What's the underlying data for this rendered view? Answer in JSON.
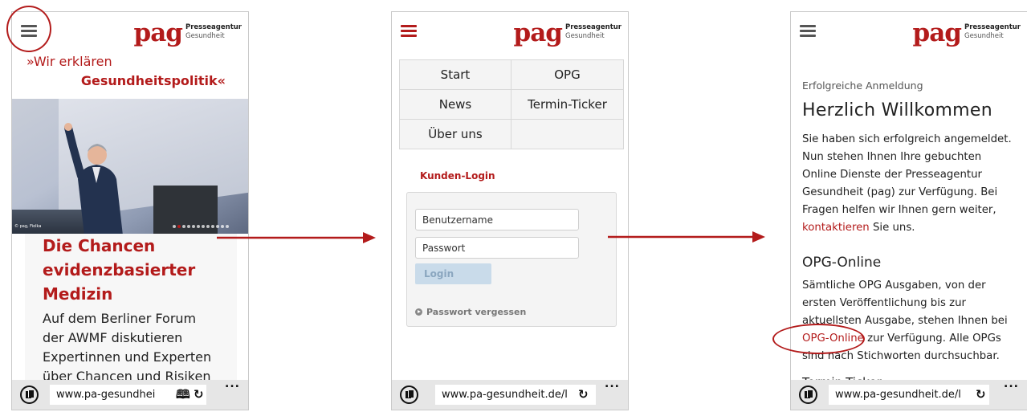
{
  "colors": {
    "brand_red": "#b31b1b",
    "text": "#222222",
    "bar_gray": "#e6e6e6",
    "login_btn": "#c9dbea"
  },
  "logo": {
    "mark": "pag",
    "line1": "Presseagentur",
    "line2": "Gesundheit"
  },
  "icons": {
    "menu": "hamburger-icon",
    "tabs": "tabs-icon",
    "reader": "reading-view-icon",
    "refresh": "refresh-icon",
    "more": "more-dots-icon",
    "forgot": "circle-arrow-icon"
  },
  "screen1": {
    "tagline_1": "»Wir erklären",
    "tagline_2": "Gesundheitspolitik«",
    "photo_credit": "© pag, Fiolka",
    "carousel": {
      "count": 12,
      "active": 1
    },
    "article_title": [
      "Die Chancen",
      "evidenzbasierter",
      "Medizin"
    ],
    "article_body": [
      "Auf dem Berliner Forum",
      "der AWMF diskutieren",
      "Expertinnen und Experten",
      "über Chancen und Risiken"
    ],
    "url": "www.pa-gesundhei",
    "more": "..."
  },
  "screen2": {
    "menu": [
      [
        "Start",
        "OPG"
      ],
      [
        "News",
        "Termin-Ticker"
      ],
      [
        "Über uns",
        ""
      ]
    ],
    "login_title": "Kunden-Login",
    "username_placeholder": "Benutzername",
    "password_placeholder": "Passwort",
    "login_button": "Login",
    "forgot_password": "Passwort vergessen",
    "url": "www.pa-gesundheit.de/l",
    "more": "..."
  },
  "screen3": {
    "kicker": "Erfolgreiche Anmeldung",
    "heading": "Herzlich Willkommen",
    "intro_lines": [
      "Sie haben sich erfolgreich angemeldet.",
      "Nun stehen Ihnen Ihre gebuchten",
      "Online Dienste der Presseagentur",
      "Gesundheit (pag) zur Verfügung. Bei",
      "Fragen helfen wir Ihnen gern weiter,"
    ],
    "contact_link": "kontaktieren",
    "contact_rest": " Sie uns.",
    "opg_heading": "OPG-Online",
    "opg_lines": [
      "Sämtliche OPG Ausgaben, von der",
      "ersten Veröffentlichung bis zur",
      "aktuellsten Ausgabe, stehen Ihnen bei"
    ],
    "opg_link": "OPG-Online",
    "opg_rest": " zur Verfügung. Alle OPGs",
    "opg_last": "sind nach Stichworten durchsuchbar.",
    "cutoff": "Termin-Ticker",
    "url": "www.pa-gesundheit.de/l",
    "more": "..."
  }
}
